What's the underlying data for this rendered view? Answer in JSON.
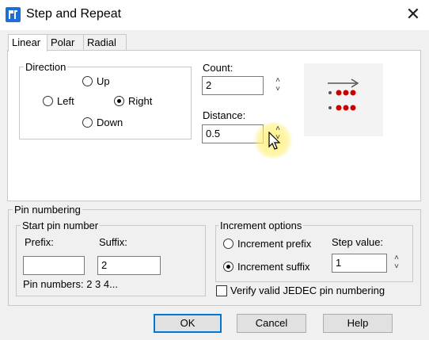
{
  "window": {
    "title": "Step and Repeat"
  },
  "tabs": [
    {
      "label": "Linear",
      "active": true
    },
    {
      "label": "Polar",
      "active": false
    },
    {
      "label": "Radial",
      "active": false
    }
  ],
  "direction": {
    "label": "Direction",
    "options": {
      "up": "Up",
      "left": "Left",
      "right": "Right",
      "down": "Down"
    },
    "selected": "Right"
  },
  "count": {
    "label": "Count:",
    "value": "2"
  },
  "distance": {
    "label": "Distance:",
    "value": "0.5"
  },
  "pin_numbering": {
    "label": "Pin numbering",
    "start_pin": {
      "label": "Start pin number",
      "prefix_label": "Prefix:",
      "prefix_value": "",
      "suffix_label": "Suffix:",
      "suffix_value": "2",
      "pin_numbers": "Pin numbers:  2 3 4..."
    },
    "increment": {
      "label": "Increment options",
      "prefix_option": "Increment prefix",
      "suffix_option": "Increment suffix",
      "selected": "Increment suffix",
      "step_label": "Step value:",
      "step_value": "1"
    },
    "verify_label": "Verify valid JEDEC pin numbering",
    "verify_checked": false
  },
  "buttons": {
    "ok": "OK",
    "cancel": "Cancel",
    "help": "Help"
  },
  "colors": {
    "accent": "#0078d7",
    "pin_dot": "#cc0000",
    "preview_bg": "#f3f3f3"
  },
  "icons": {
    "app": "step-repeat-app-icon",
    "close": "close-icon"
  }
}
